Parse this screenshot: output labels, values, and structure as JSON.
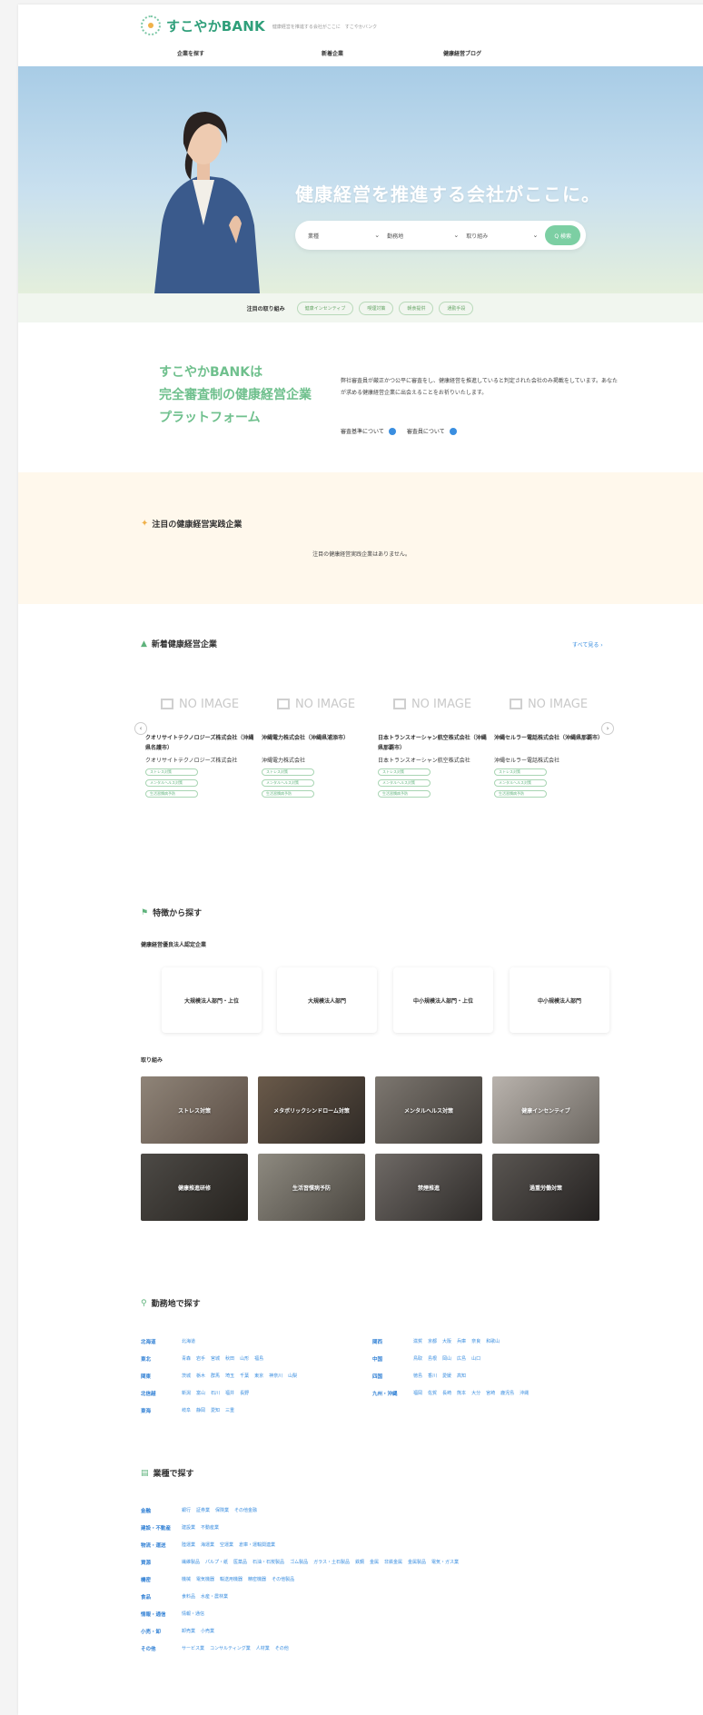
{
  "brand": {
    "name": "すこやかBANK",
    "tagline": "健康経営を推進する会社がここに　すこやかバンク",
    "accent": "#7ccfa3",
    "link": "#3a8ee0"
  },
  "nav": [
    "企業を探す",
    "新着企業",
    "健康経営ブログ"
  ],
  "hero": {
    "title": "健康経営を推進する会社がここに。",
    "selects": [
      "業種",
      "勤務地",
      "取り組み"
    ],
    "search_button": "Q 検索"
  },
  "pick": {
    "label": "注目の取り組み",
    "pills": [
      "健康インセンティブ",
      "喫煙対策",
      "朝食提供",
      "通勤手段"
    ]
  },
  "intro": {
    "heading": [
      "すこやかBANKは",
      "完全審査制の健康経営企業",
      "プラットフォーム"
    ],
    "body": "弊社審査員が厳正かつ公平に審査をし、健康経営を推進していると判定された会社のみ掲載をしています。あなたが求める健康経営企業に出会えることをお祈りいたします。",
    "links": [
      "審査基準について",
      "審査員について"
    ]
  },
  "featured": {
    "title": "注目の健康経営実践企業",
    "empty": "注目の健康経営実践企業はありません。"
  },
  "new": {
    "title": "新着健康経営企業",
    "see_all": "すべて見る ›",
    "noimage": "NO IMAGE",
    "cards": [
      {
        "title": "クオリサイトテクノロジーズ株式会社（沖縄県名護市）",
        "company": "クオリサイトテクノロジーズ株式会社",
        "tags": [
          "ストレス対策",
          "メンタルヘルス対策",
          "生活習慣病予防"
        ]
      },
      {
        "title": "沖縄電力株式会社（沖縄県浦添市）",
        "company": "沖縄電力株式会社",
        "tags": [
          "ストレス対策",
          "メンタルヘルス対策",
          "生活習慣病予防"
        ]
      },
      {
        "title": "日本トランスオーシャン航空株式会社（沖縄県那覇市）",
        "company": "日本トランスオーシャン航空株式会社",
        "tags": [
          "ストレス対策",
          "メンタルヘルス対策",
          "生活習慣病予防"
        ]
      },
      {
        "title": "沖縄セルラー電話株式会社（沖縄県那覇市）",
        "company": "沖縄セルラー電話株式会社",
        "tags": [
          "ストレス対策",
          "メンタルヘルス対策",
          "生活習慣病予防"
        ]
      }
    ]
  },
  "features": {
    "title": "特徴から探す",
    "cert_label": "健康経営優良法人認定企業",
    "certs": [
      "大規模法人部門・上位",
      "大規模法人部門",
      "中小規模法人部門・上位",
      "中小規模法人部門"
    ],
    "initiatives_label": "取り組み",
    "initiatives": [
      "ストレス対策",
      "メタボリックシンドローム対策",
      "メンタルヘルス対策",
      "健康インセンティブ",
      "健康推進研修",
      "生活習慣病予防",
      "禁煙推進",
      "過重労働対策"
    ]
  },
  "region": {
    "title": "勤務地で探す",
    "left": [
      {
        "name": "北海道",
        "items": [
          "北海道"
        ]
      },
      {
        "name": "東北",
        "items": [
          "青森",
          "岩手",
          "宮城",
          "秋田",
          "山形",
          "福島"
        ]
      },
      {
        "name": "関東",
        "items": [
          "茨城",
          "栃木",
          "群馬",
          "埼玉",
          "千葉",
          "東京",
          "神奈川",
          "山梨"
        ]
      },
      {
        "name": "北信越",
        "items": [
          "新潟",
          "富山",
          "石川",
          "福井",
          "長野"
        ]
      },
      {
        "name": "東海",
        "items": [
          "岐阜",
          "静岡",
          "愛知",
          "三重"
        ]
      }
    ],
    "right": [
      {
        "name": "関西",
        "items": [
          "滋賀",
          "京都",
          "大阪",
          "兵庫",
          "奈良",
          "和歌山"
        ]
      },
      {
        "name": "中国",
        "items": [
          "鳥取",
          "島根",
          "岡山",
          "広島",
          "山口"
        ]
      },
      {
        "name": "四国",
        "items": [
          "徳島",
          "香川",
          "愛媛",
          "高知"
        ]
      },
      {
        "name": "九州・沖縄",
        "items": [
          "福岡",
          "佐賀",
          "長崎",
          "熊本",
          "大分",
          "宮崎",
          "鹿児島",
          "沖縄"
        ]
      }
    ]
  },
  "industry": {
    "title": "業種で探す",
    "rows": [
      {
        "name": "金融",
        "items": [
          "銀行",
          "証券業",
          "保険業",
          "その他金融"
        ]
      },
      {
        "name": "建設・不動産",
        "items": [
          "建設業",
          "不動産業"
        ]
      },
      {
        "name": "物流・運送",
        "items": [
          "陸運業",
          "海運業",
          "空運業",
          "倉庫・運輸関連業"
        ]
      },
      {
        "name": "資源",
        "items": [
          "繊維製品",
          "パルプ・紙",
          "医薬品",
          "石油・石炭製品",
          "ゴム製品",
          "ガラス・土石製品",
          "鉄鋼",
          "金属",
          "非鉄金属",
          "金属製品",
          "電気・ガス業"
        ]
      },
      {
        "name": "機密",
        "items": [
          "機械",
          "電気機器",
          "輸送用機器",
          "精密機器",
          "その他製品"
        ]
      },
      {
        "name": "食品",
        "items": [
          "食料品",
          "水産・農林業"
        ]
      },
      {
        "name": "情報・通信",
        "items": [
          "情報・通信"
        ]
      },
      {
        "name": "小売・卸",
        "items": [
          "卸売業",
          "小売業"
        ]
      },
      {
        "name": "その他",
        "items": [
          "サービス業",
          "コンサルティング業",
          "人材業",
          "その他"
        ]
      }
    ]
  }
}
